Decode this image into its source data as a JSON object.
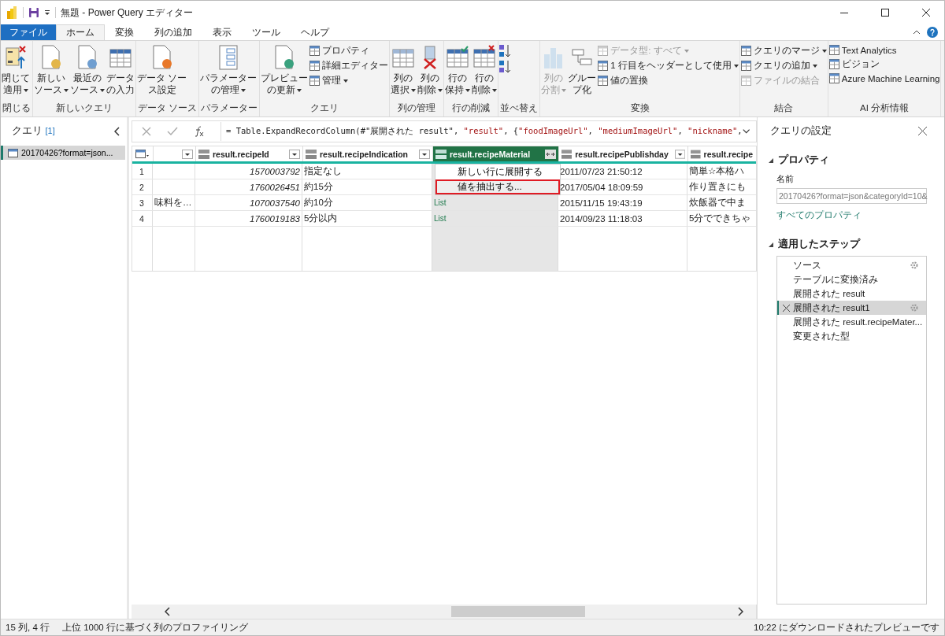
{
  "window": {
    "title": "無題 - Power Query エディター"
  },
  "tabs": [
    {
      "label": "ファイル",
      "kind": "file",
      "selected": false
    },
    {
      "label": "ホーム",
      "kind": "tab",
      "selected": true
    },
    {
      "label": "変換",
      "kind": "tab",
      "selected": false
    },
    {
      "label": "列の追加",
      "kind": "tab",
      "selected": false
    },
    {
      "label": "表示",
      "kind": "tab",
      "selected": false
    },
    {
      "label": "ツール",
      "kind": "tab",
      "selected": false
    },
    {
      "label": "ヘルプ",
      "kind": "tab",
      "selected": false
    }
  ],
  "ribbon": [
    {
      "label": "閉じる",
      "items": [
        {
          "kind": "large",
          "lines": [
            "閉じて",
            "適用"
          ],
          "dropdown": true,
          "disabled": false
        }
      ]
    },
    {
      "label": "新しいクエリ",
      "items": [
        {
          "kind": "large",
          "lines": [
            "新しい",
            "ソース"
          ],
          "dropdown": true,
          "disabled": false
        },
        {
          "kind": "large",
          "lines": [
            "最近の",
            "ソース"
          ],
          "dropdown": true,
          "disabled": false
        },
        {
          "kind": "large",
          "lines": [
            "データ",
            "の入力"
          ],
          "dropdown": false,
          "disabled": false
        }
      ]
    },
    {
      "label": "データ ソース",
      "items": [
        {
          "kind": "large",
          "lines": [
            "データ ソー",
            "ス設定"
          ],
          "dropdown": false,
          "disabled": false
        }
      ]
    },
    {
      "label": "パラメーター",
      "items": [
        {
          "kind": "large",
          "lines": [
            "パラメーター",
            "の管理"
          ],
          "dropdown": true,
          "disabled": false
        }
      ]
    },
    {
      "label": "クエリ",
      "items": [
        {
          "kind": "large",
          "lines": [
            "プレビュー",
            "の更新"
          ],
          "dropdown": true,
          "disabled": false
        },
        {
          "kind": "stack",
          "items": [
            {
              "label": "プロパティ",
              "dropdown": false,
              "disabled": false
            },
            {
              "label": "詳細エディター",
              "dropdown": false,
              "disabled": false
            },
            {
              "label": "管理",
              "dropdown": true,
              "disabled": false
            }
          ]
        }
      ]
    },
    {
      "label": "列の管理",
      "items": [
        {
          "kind": "large",
          "lines": [
            "列の",
            "選択"
          ],
          "dropdown": true,
          "disabled": false
        },
        {
          "kind": "large",
          "lines": [
            "列の",
            "削除"
          ],
          "dropdown": true,
          "disabled": false
        }
      ]
    },
    {
      "label": "行の削減",
      "items": [
        {
          "kind": "large",
          "lines": [
            "行の",
            "保持"
          ],
          "dropdown": true,
          "disabled": false
        },
        {
          "kind": "large",
          "lines": [
            "行の",
            "削除"
          ],
          "dropdown": true,
          "disabled": false
        }
      ]
    },
    {
      "label": "並べ替え",
      "items": [
        {
          "kind": "sort"
        }
      ]
    },
    {
      "label": "変換",
      "items": [
        {
          "kind": "large",
          "lines": [
            "列の",
            "分割"
          ],
          "dropdown": true,
          "disabled": true
        },
        {
          "kind": "large",
          "lines": [
            "グルー",
            "プ化"
          ],
          "dropdown": false,
          "disabled": false
        },
        {
          "kind": "stack",
          "items": [
            {
              "label": "データ型: すべて",
              "dropdown": true,
              "disabled": true
            },
            {
              "label": "1 行目をヘッダーとして使用",
              "dropdown": true,
              "disabled": false
            },
            {
              "label": "値の置換",
              "dropdown": false,
              "disabled": false
            }
          ]
        }
      ]
    },
    {
      "label": "結合",
      "items": [
        {
          "kind": "stack",
          "items": [
            {
              "label": "クエリのマージ",
              "dropdown": true,
              "disabled": false
            },
            {
              "label": "クエリの追加",
              "dropdown": true,
              "disabled": false
            },
            {
              "label": "ファイルの結合",
              "dropdown": false,
              "disabled": true
            }
          ]
        }
      ]
    },
    {
      "label": "AI 分析情報",
      "items": [
        {
          "kind": "stack",
          "items": [
            {
              "label": "Text Analytics",
              "dropdown": false,
              "disabled": false
            },
            {
              "label": "ビジョン",
              "dropdown": false,
              "disabled": false
            },
            {
              "label": "Azure Machine Learning",
              "dropdown": false,
              "disabled": false
            }
          ]
        }
      ]
    }
  ],
  "queries": {
    "title": "クエリ",
    "count": "[1]",
    "items": [
      {
        "label": "20170426?format=json...",
        "selected": true
      }
    ]
  },
  "formula": [
    {
      "text": "= Table.ExpandRecordColumn(#\"展開された result\", ",
      "kind": "code"
    },
    {
      "text": "\"result\"",
      "kind": "string"
    },
    {
      "text": ", {",
      "kind": "code"
    },
    {
      "text": "\"foodImageUrl\"",
      "kind": "string"
    },
    {
      "text": ", ",
      "kind": "code"
    },
    {
      "text": "\"mediumImageUrl\"",
      "kind": "string"
    },
    {
      "text": ", ",
      "kind": "code"
    },
    {
      "text": "\"nickname\"",
      "kind": "string"
    },
    {
      "text": ",",
      "kind": "code"
    }
  ],
  "table": {
    "columns": [
      {
        "selected": false
      },
      {
        "name": "result.recipeId",
        "selected": false
      },
      {
        "name": "result.recipeIndication",
        "selected": false
      },
      {
        "name": "result.recipeMaterial",
        "selected": true
      },
      {
        "name": "result.recipePublishday",
        "selected": false
      },
      {
        "name": "result.recipe",
        "selected": false
      }
    ],
    "rows": [
      {
        "number": "1",
        "cells": [
          null,
          "1570003792",
          "指定なし",
          null,
          "2011/07/23 21:50:12",
          "簡単☆本格ハ"
        ]
      },
      {
        "number": "2",
        "cells": [
          null,
          "1760026451",
          "約15分",
          null,
          "2017/05/04 18:09:59",
          "作り置きにも"
        ]
      },
      {
        "number": "3",
        "cells": [
          "味料を…",
          "1070037540",
          "約10分",
          "List",
          "2015/11/15 19:43:19",
          "炊飯器で中ま"
        ]
      },
      {
        "number": "4",
        "cells": [
          null,
          "1760019183",
          "5分以内",
          "List",
          "2014/09/23 11:18:03",
          "5分でできちゃ"
        ]
      }
    ]
  },
  "context_menu": [
    {
      "label": "新しい行に展開する",
      "selected": false
    },
    {
      "label": "値を抽出する...",
      "selected": true
    }
  ],
  "settings": {
    "title": "クエリの設定",
    "properties_heading": "プロパティ",
    "name_label": "名前",
    "name_value": "20170426?format=json&categoryId=10&",
    "all_properties": "すべてのプロパティ",
    "steps_heading": "適用したステップ",
    "steps": [
      {
        "label": "ソース",
        "selected": false,
        "gear": true
      },
      {
        "label": "テーブルに変換済み",
        "selected": false,
        "gear": false
      },
      {
        "label": "展開された result",
        "selected": false,
        "gear": false
      },
      {
        "label": "展開された result1",
        "selected": true,
        "gear": true
      },
      {
        "label": "展開された result.recipeMater...",
        "selected": false,
        "gear": false
      },
      {
        "label": "変更された型",
        "selected": false,
        "gear": false
      }
    ]
  },
  "status_bar": {
    "left": "15 列, 4 行",
    "profiling": "上位 1000 行に基づく列のプロファイリング",
    "right": "10:22 にダウンロードされたプレビューです"
  }
}
